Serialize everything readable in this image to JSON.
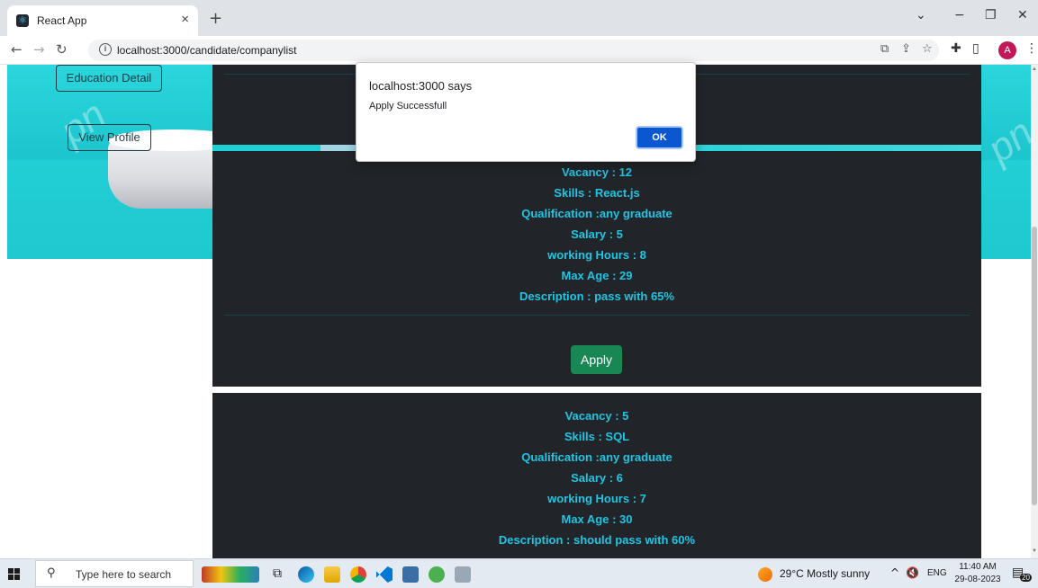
{
  "browser": {
    "tab_title": "React App",
    "tab_close": "×",
    "new_tab": "+",
    "url": "localhost:3000/candidate/companylist",
    "profile_initial": "A"
  },
  "sidebar": {
    "education_button": "Education Detail",
    "profile_button": "View Profile"
  },
  "cards": [
    {
      "lines": [
        "Vacancy : 12",
        "Skills : React.js",
        "Qualification :any graduate",
        "Salary : 5",
        "working Hours : 8",
        "Max Age : 29",
        "Description : pass with 65%"
      ],
      "apply_label": "Apply"
    },
    {
      "lines": [
        "Vacancy : 5",
        "Skills : SQL",
        "Qualification :any graduate",
        "Salary : 6",
        "working Hours : 7",
        "Max Age : 30",
        "Description : should pass with 60%"
      ]
    }
  ],
  "dialog": {
    "title": "localhost:3000 says",
    "message": "Apply Successfull",
    "ok_label": "OK"
  },
  "taskbar": {
    "search_placeholder": "Type here to search",
    "weather": "29°C  Mostly sunny",
    "language": "ENG",
    "time": "11:40 AM",
    "date": "29-08-2023",
    "notifications": "20"
  },
  "colors": {
    "card_bg": "#212529",
    "card_text": "#1fc5e3",
    "apply_green": "#198754",
    "dialog_ok": "#0b57d0",
    "hero_cyan": "#1fc8d0"
  }
}
